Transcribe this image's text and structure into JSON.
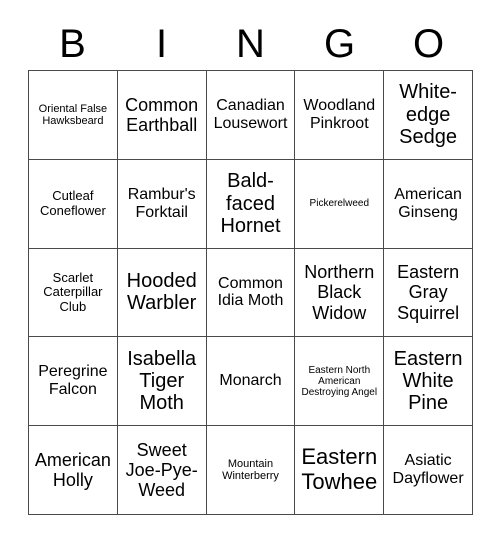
{
  "card": {
    "header_letters": [
      "B",
      "I",
      "N",
      "G",
      "O"
    ],
    "columns": 5,
    "rows": 5,
    "text_color": "#000000",
    "background_color": "#ffffff",
    "border_color": "#4a4a4a",
    "cells": [
      {
        "text": "Oriental False Hawksbeard",
        "size": "xs"
      },
      {
        "text": "Common Earthball",
        "size": "lg"
      },
      {
        "text": "Canadian Lousewort",
        "size": "md"
      },
      {
        "text": "Woodland Pinkroot",
        "size": "md"
      },
      {
        "text": "White-edge Sedge",
        "size": "xl"
      },
      {
        "text": "Cutleaf Coneflower",
        "size": "sm"
      },
      {
        "text": "Rambur's Forktail",
        "size": "md"
      },
      {
        "text": "Bald-faced Hornet",
        "size": "xl"
      },
      {
        "text": "Pickerelweed",
        "size": "xxs"
      },
      {
        "text": "American Ginseng",
        "size": "md"
      },
      {
        "text": "Scarlet Caterpillar Club",
        "size": "sm"
      },
      {
        "text": "Hooded Warbler",
        "size": "xl"
      },
      {
        "text": "Common Idia Moth",
        "size": "md"
      },
      {
        "text": "Northern Black Widow",
        "size": "lg"
      },
      {
        "text": "Eastern Gray Squirrel",
        "size": "lg"
      },
      {
        "text": "Peregrine Falcon",
        "size": "md"
      },
      {
        "text": "Isabella Tiger Moth",
        "size": "xl"
      },
      {
        "text": "Monarch",
        "size": "md"
      },
      {
        "text": "Eastern North American Destroying Angel",
        "size": "xxs"
      },
      {
        "text": "Eastern White Pine",
        "size": "xl"
      },
      {
        "text": "American Holly",
        "size": "lg"
      },
      {
        "text": "Sweet Joe-Pye-Weed",
        "size": "lg"
      },
      {
        "text": "Mountain Winterberry",
        "size": "xs"
      },
      {
        "text": "Eastern Towhee",
        "size": "xxl"
      },
      {
        "text": "Asiatic Dayflower",
        "size": "md"
      }
    ]
  }
}
